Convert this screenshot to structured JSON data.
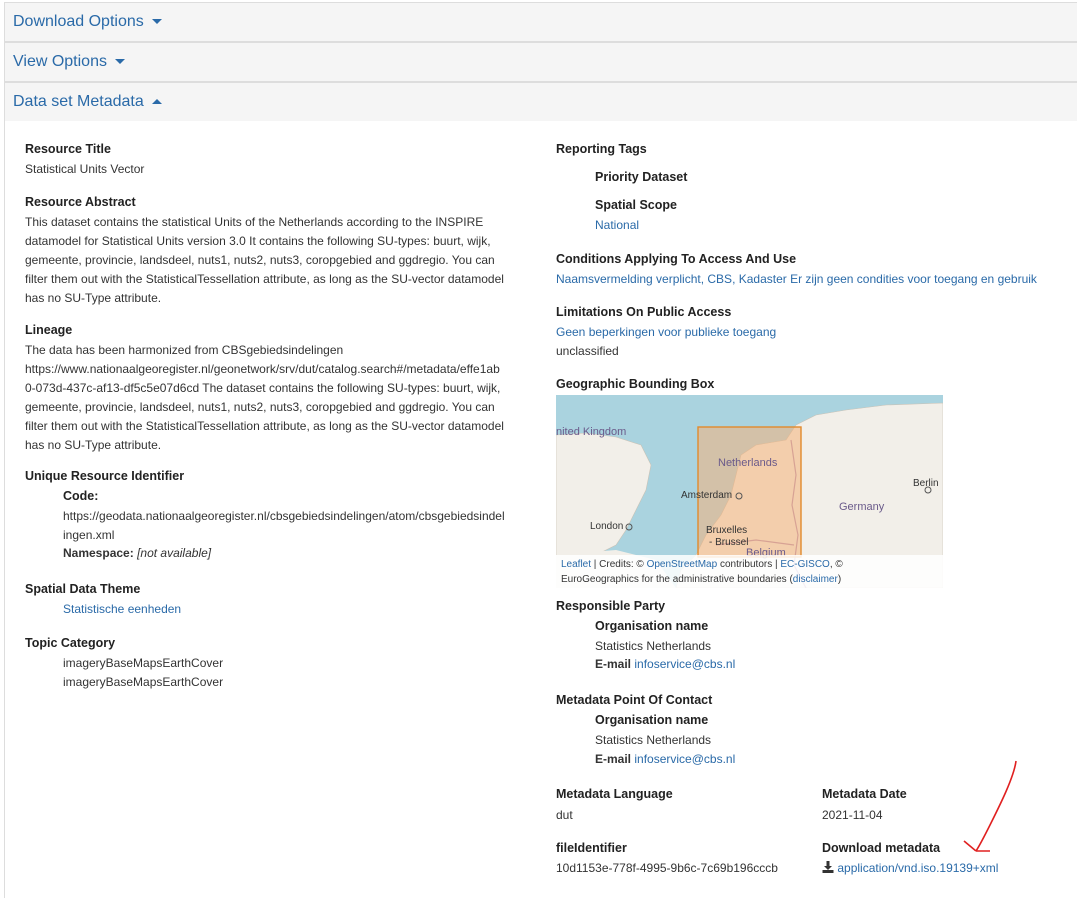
{
  "sections": {
    "download": "Download Options",
    "view": "View Options",
    "metadata": "Data set Metadata"
  },
  "left": {
    "resource_title_h": "Resource Title",
    "resource_title": "Statistical Units Vector",
    "abstract_h": "Resource Abstract",
    "abstract_lines": [
      "This dataset contains the statistical Units of the Netherlands according to the INSPIRE",
      "datamodel for Statistical Units version 3.0 It contains the following SU-types: buurt, wijk,",
      "gemeente, provincie, landsdeel, nuts1, nuts2, nuts3, coropgebied and ggdregio. You can",
      "filter them out with the StatisticalTessellation attribute, as long as the SU-vector datamodel",
      "has no SU-Type attribute."
    ],
    "lineage_h": "Lineage",
    "lineage_lines": [
      "The data has been harmonized from CBSgebiedsindelingen",
      "https://www.nationaalgeoregister.nl/geonetwork/srv/dut/catalog.search#/metadata/effe1ab",
      "0-073d-437c-af13-df5c5e07d6cd The dataset contains the following SU-types: buurt, wijk,",
      "gemeente, provincie, landsdeel, nuts1, nuts2, nuts3, coropgebied and ggdregio. You can",
      "filter them out with the StatisticalTessellation attribute, as long as the SU-vector datamodel",
      "has no SU-Type attribute."
    ],
    "uri_h": "Unique Resource Identifier",
    "code_label": "Code:",
    "code_line1": "https://geodata.nationaalgeoregister.nl/cbsgebiedsindelingen/atom/cbsgebiedsindel",
    "code_line2": "ingen.xml",
    "namespace_label": "Namespace:",
    "namespace_value": "[not available]",
    "theme_h": "Spatial Data Theme",
    "theme_value": "Statistische eenheden",
    "topic_h": "Topic Category",
    "topic_values": [
      "imageryBaseMapsEarthCover",
      "imageryBaseMapsEarthCover"
    ]
  },
  "right": {
    "tags_h": "Reporting Tags",
    "priority_h": "Priority Dataset",
    "scope_h": "Spatial Scope",
    "scope_value": "National",
    "conditions_h": "Conditions Applying To Access And Use",
    "conditions_value": "Naamsvermelding verplicht, CBS, Kadaster Er zijn geen condities voor toegang en gebruik",
    "limits_h": "Limitations On Public Access",
    "limits_link": "Geen beperkingen voor publieke toegang",
    "limits_value": "unclassified",
    "bbox_h": "Geographic Bounding Box",
    "map": {
      "labels": {
        "uk": "nited Kingdom",
        "nl": "Netherlands",
        "amsterdam": "Amsterdam",
        "london": "London",
        "bruxelles": "Bruxelles",
        "brussel": "- Brussel",
        "belgium": "Belgium",
        "germany": "Germany",
        "berlin": "Berlin"
      },
      "attr_leaflet": "Leaflet",
      "attr_credits": " | Credits: © ",
      "attr_osm": "OpenStreetMap",
      "attr_contrib": " contributors | ",
      "attr_ecgisco": "EC-GISCO",
      "attr_copy": ", ©",
      "attr_line2": "EuroGeographics for the administrative boundaries (",
      "attr_disclaimer": "disclaimer",
      "attr_close": ")"
    },
    "party_h": "Responsible Party",
    "org_label": "Organisation name",
    "org_value": "Statistics Netherlands",
    "email_label": "E-mail",
    "email_value": "infoservice@cbs.nl",
    "poc_h": "Metadata Point Of Contact",
    "poc_org_label": "Organisation name",
    "poc_org_value": "Statistics Netherlands",
    "poc_email_label": "E-mail",
    "poc_email_value": "infoservice@cbs.nl",
    "lang_h": "Metadata Language",
    "lang_value": "dut",
    "date_h": "Metadata Date",
    "date_value": "2021-11-04",
    "fileid_h": "fileIdentifier",
    "fileid_value": "10d1153e-778f-4995-9b6c-7c69b196cccb",
    "dl_h": "Download metadata",
    "dl_link": "application/vnd.iso.19139+xml"
  },
  "colors": {
    "link": "#2a6aa8",
    "bbox_fill": "#f4b27a",
    "annotation_arrow": "#e02020"
  }
}
